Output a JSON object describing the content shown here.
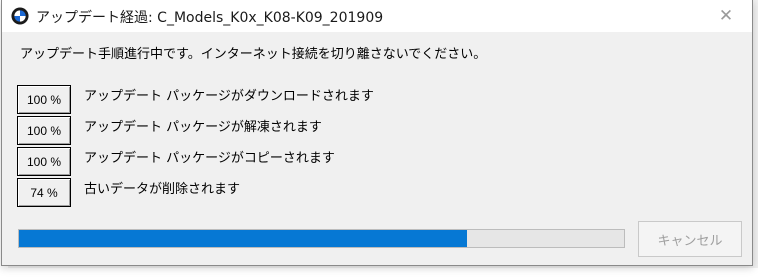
{
  "window": {
    "title": "アップデート経過: C_Models_K0x_K08-K09_201909",
    "icon": "bmw-logo-icon",
    "close_glyph": "✕"
  },
  "notice": "アップデート手順進行中です。インターネット接続を切り離さないでください。",
  "steps": [
    {
      "percent": "100 %",
      "label": "アップデート パッケージがダウンロードされます"
    },
    {
      "percent": "100 %",
      "label": "アップデート パッケージが解凍されます"
    },
    {
      "percent": "100 %",
      "label": "アップデート パッケージがコピーされます"
    },
    {
      "percent": "74 %",
      "label": "古いデータが削除されます"
    }
  ],
  "progress": {
    "fraction": 0.74,
    "color": "#0678d4"
  },
  "cancel_label": "キャンセル"
}
